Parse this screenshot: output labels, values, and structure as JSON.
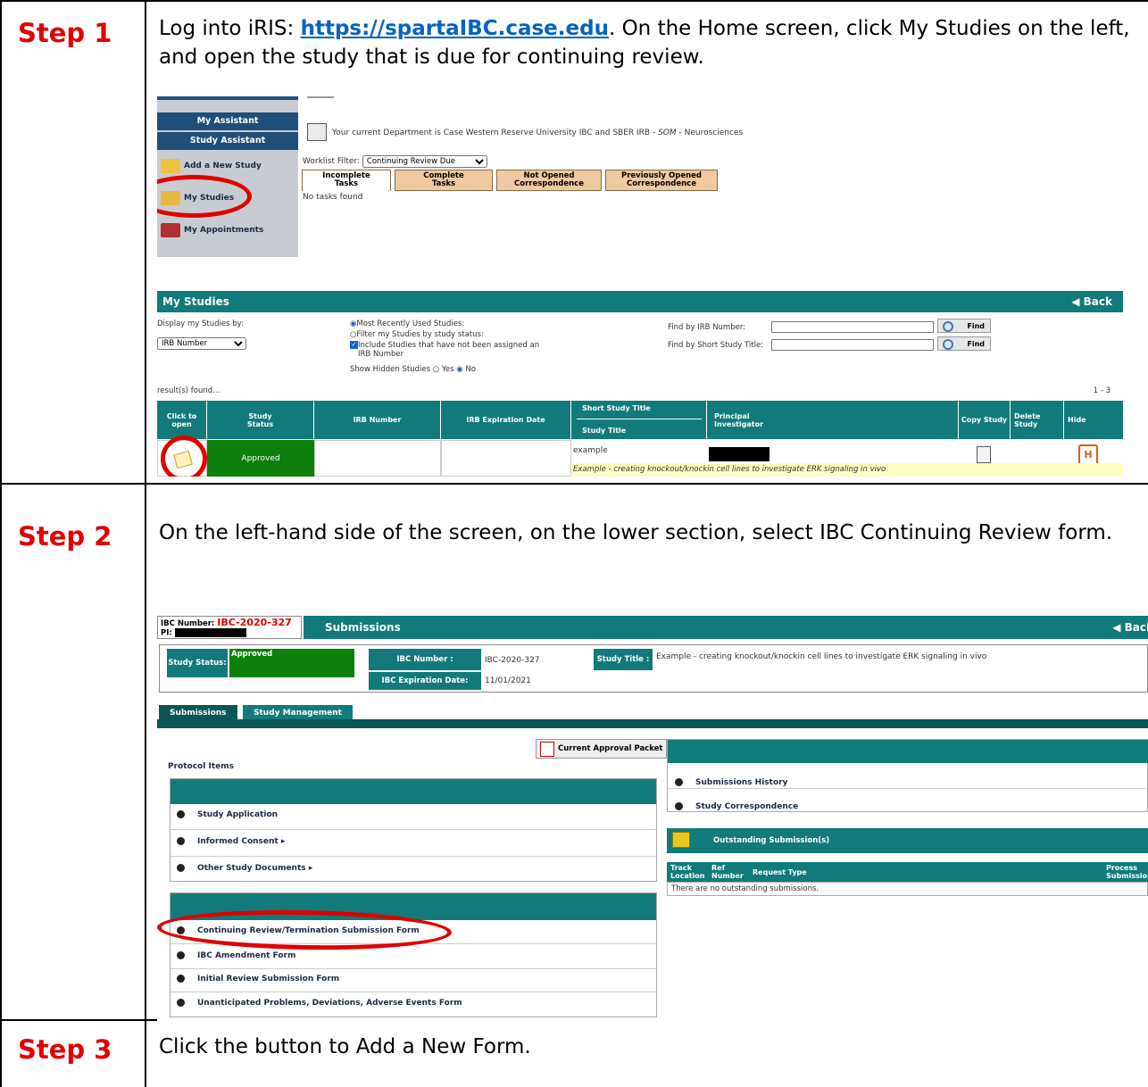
{
  "steps": [
    {
      "label": "Step 1",
      "text_before": "Log into iRIS: ",
      "link": "https://spartaIBC.case.edu",
      "text_after": ". On the Home screen, click My Studies on the left, and open the study that is due for continuing review."
    },
    {
      "label": "Step 2",
      "text": "On the left-hand side of the screen, on the lower section, select IBC Continuing Review form."
    },
    {
      "label": "Step 3",
      "text": "Click the button to Add a New Form."
    }
  ],
  "screen1": {
    "sidebar": {
      "my_assistant": "My Assistant",
      "study_assistant": "Study Assistant",
      "add_new_study": "Add a New Study",
      "my_studies": "My Studies",
      "my_appointments": "My Appointments"
    },
    "department_prefix": "Your current Department is Case Western Reserve University IBC and SBER IRB - ",
    "department_italic": "SOM",
    "department_suffix": " - Neurosciences",
    "worklist_label": "Worklist Filter:",
    "worklist_value": "Continuing Review Due",
    "tabs": [
      {
        "l1": "Incomplete",
        "l2": "Tasks"
      },
      {
        "l1": "Complete",
        "l2": "Tasks"
      },
      {
        "l1": "Not Opened",
        "l2": "Correspondence"
      },
      {
        "l1": "Previously Opened",
        "l2": "Correspondence"
      }
    ],
    "no_tasks": "No tasks found",
    "my_studies_title": "My Studies",
    "back": "Back",
    "display_by_label": "Display my Studies by:",
    "display_by_value": "IRB Number",
    "radio_recent": "Most Recently Used Studies:",
    "radio_filter": "Filter my Studies by study status:",
    "checkbox_include_1": "Include Studies that have not been assigned an",
    "checkbox_include_2": "IRB Number",
    "show_hidden": "Show Hidden Studies",
    "yes": "Yes",
    "no": "No",
    "find_irb": "Find by IRB Number:",
    "find_title": "Find by Short Study Title:",
    "find": "Find",
    "results": "result(s) found...",
    "range": "1 - 3",
    "columns": {
      "click_open_1": "Click to",
      "click_open_2": "open",
      "status_1": "Study",
      "status_2": "Status",
      "irb_number": "IRB Number",
      "irb_exp": "IRB Expiration Date",
      "short_title": "Short Study Title",
      "study_title": "Study Title",
      "pi_1": "Principal",
      "pi_2": "Investigator",
      "copy": "Copy Study",
      "delete_1": "Delete",
      "delete_2": "Study",
      "hide": "Hide"
    },
    "row_status": "Approved",
    "row_short_title": "example",
    "row_title": "Example - creating knockout/knockin cell lines to investigate ERK signaling in vivo"
  },
  "screen2": {
    "ibc_label": "IBC Number:",
    "ibc_value": "IBC-2020-327",
    "pi_label": "PI:",
    "title": "Submissions",
    "back": "Back",
    "study_status_label": "Study Status:",
    "study_status_value": "Approved",
    "ibc_number_label": "IBC Number :",
    "ibc_number_value": "IBC-2020-327",
    "study_title_label": "Study Title :",
    "study_title_value": "Example - creating knockout/knockin cell lines to investigate ERK signaling in vivo",
    "exp_label": "IBC Expiration Date:",
    "exp_value": "11/01/2021",
    "tab_submissions": "Submissions",
    "tab_management": "Study Management",
    "approval_packet": "Current Approval Packet",
    "protocol_items": "Protocol Items",
    "items": [
      "Study Application",
      "Informed Consent",
      "Other Study Documents"
    ],
    "forms": [
      "Continuing Review/Termination Submission Form",
      "IBC Amendment Form",
      "Initial Review Submission Form",
      "Unanticipated Problems, Deviations, Adverse Events Form"
    ],
    "right_items": [
      "Submissions History",
      "Study Correspondence"
    ],
    "outstanding": "Outstanding Submission(s)",
    "out_cols": {
      "track_1": "Track",
      "track_2": "Location",
      "ref_1": "Ref",
      "ref_2": "Number",
      "request": "Request Type",
      "process_1": "Process",
      "process_2": "Submission"
    },
    "no_outstanding": "There are no outstanding submissions."
  },
  "colors": {
    "step_red": "#e00000",
    "link_blue": "#0563c1",
    "teal": "#127a7a",
    "approved_green": "#0d7f0d"
  }
}
